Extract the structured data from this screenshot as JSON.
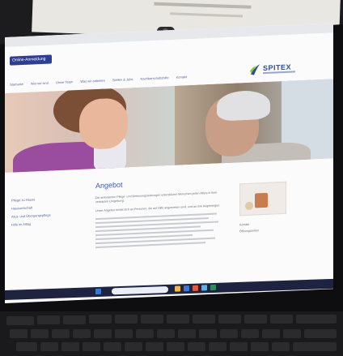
{
  "site": {
    "brand": "SPITEX",
    "button_label": "Online-Anmeldung"
  },
  "nav": {
    "items": [
      "Startseite",
      "Wer wir sind",
      "Unser Team",
      "Was wir anbieten",
      "Stellen & Jobs",
      "Nachbarschaftshilfe",
      "Kontakt"
    ]
  },
  "sidebar": {
    "items": [
      "Pflege zu Hause",
      "Hauswirtschaft",
      "Akut- und Übergangspflege",
      "Hilfe im Alltag"
    ]
  },
  "main": {
    "title": "Angebot",
    "paragraphs": [
      "Die ambulanten Pflege- und Betreuungsleistungen unterstützen Menschen jeden Alters in ihrer vertrauten Umgebung.",
      "Unser Angebot richtet sich an Personen, die auf Hilfe angewiesen sind, und an ihre Angehörigen."
    ]
  },
  "right": {
    "items": [
      "Kontakt",
      "Öffnungszeiten"
    ]
  },
  "colors": {
    "accent": "#2f3f8f",
    "title": "#3c58a6"
  }
}
